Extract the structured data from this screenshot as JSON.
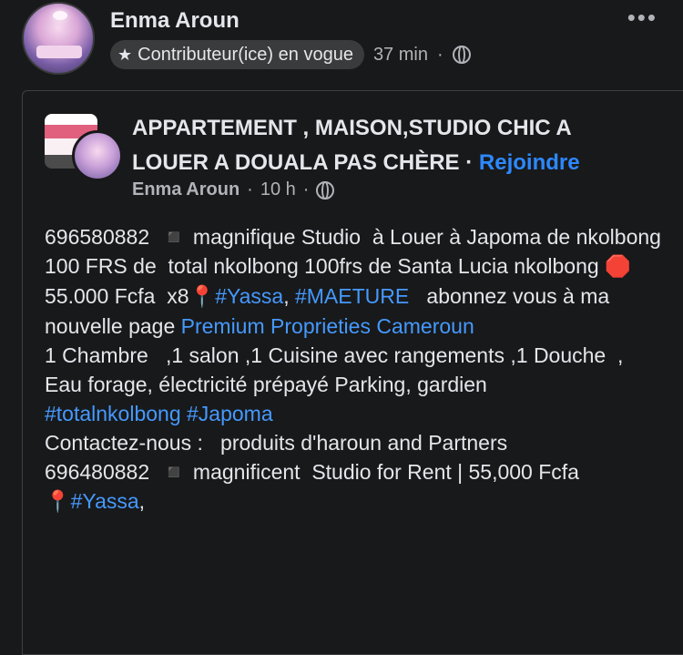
{
  "header": {
    "author": "Enma Aroun",
    "badge": "Contributeur(ice) en vogue",
    "time": "37 min",
    "more": "•••"
  },
  "group": {
    "title": "APPARTEMENT ,  MAISON,STUDIO CHIC A LOUER A DOUALA PAS CHÈRE",
    "sep": " · ",
    "join": "Rejoindre",
    "author": "Enma Aroun",
    "time": "10 h"
  },
  "post": {
    "l1": "696580882  ◾ magnifique Studio  à Louer à Japoma de nkolbong 100 FRS de  total nkolbong 100frs de Santa Lucia nkolbong ",
    "stop": "🛑",
    "l2": " 55.000 Fcfa  x8",
    "pin": "📍",
    "tag1": "#Yassa",
    "comma1": ", ",
    "tag2": "#MAETURE",
    "l3": "   abonnez vous à ma nouvelle page ",
    "link": "Premium Proprieties Cameroun",
    "l4": "\n1 Chambre   ,1 salon ,1 Cuisine avec rangements ,1 Douche  , Eau forage, électricité prépayé Parking, gardien        ",
    "tag3": "#totalnkolbong",
    "space": " ",
    "tag4": "#Japoma",
    "l5": "\nContactez-nous :   produits d'haroun and Partners\n696480882  ◾ magnificent  Studio for Rent | 55,000 Fcfa\n",
    "pin2": "📍",
    "tag5": "#Yassa",
    "comma2": ","
  }
}
